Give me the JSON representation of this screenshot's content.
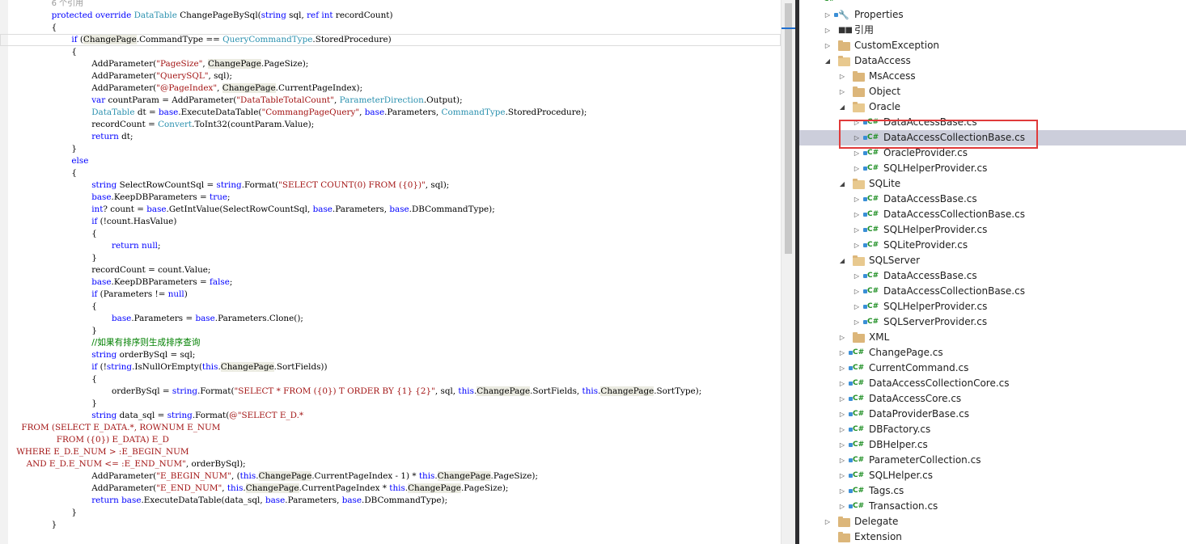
{
  "editor": {
    "lines": [
      {
        "indent": 8,
        "tokens": [
          {
            "t": "6 个引用",
            "c": "ref"
          }
        ]
      },
      {
        "indent": 8,
        "tokens": [
          {
            "t": "protected",
            "c": "kw"
          },
          {
            "t": " "
          },
          {
            "t": "override",
            "c": "kw"
          },
          {
            "t": " "
          },
          {
            "t": "DataTable",
            "c": "type"
          },
          {
            "t": " ChangePageBySql("
          },
          {
            "t": "string",
            "c": "kw"
          },
          {
            "t": " sql, "
          },
          {
            "t": "ref",
            "c": "kw"
          },
          {
            "t": " "
          },
          {
            "t": "int",
            "c": "kw"
          },
          {
            "t": " recordCount)"
          }
        ]
      },
      {
        "indent": 8,
        "tokens": [
          {
            "t": "{"
          }
        ]
      },
      {
        "indent": 12,
        "current": true,
        "tokens": [
          {
            "t": "if",
            "c": "kw"
          },
          {
            "t": " ("
          },
          {
            "t": "ChangePage",
            "c": "hl"
          },
          {
            "t": ".CommandType == "
          },
          {
            "t": "QueryCommandType",
            "c": "type"
          },
          {
            "t": ".StoredProcedure)"
          }
        ]
      },
      {
        "indent": 12,
        "tokens": [
          {
            "t": "{"
          }
        ]
      },
      {
        "indent": 16,
        "tokens": [
          {
            "t": "AddParameter("
          },
          {
            "t": "\"PageSize\"",
            "c": "str"
          },
          {
            "t": ", "
          },
          {
            "t": "ChangePage",
            "c": "hl"
          },
          {
            "t": ".PageSize);"
          }
        ]
      },
      {
        "indent": 16,
        "tokens": [
          {
            "t": "AddParameter("
          },
          {
            "t": "\"QuerySQL\"",
            "c": "str"
          },
          {
            "t": ", sql);"
          }
        ]
      },
      {
        "indent": 16,
        "tokens": [
          {
            "t": "AddParameter("
          },
          {
            "t": "\"@PageIndex\"",
            "c": "str"
          },
          {
            "t": ", "
          },
          {
            "t": "ChangePage",
            "c": "hl"
          },
          {
            "t": ".CurrentPageIndex);"
          }
        ]
      },
      {
        "indent": 16,
        "tokens": [
          {
            "t": "var",
            "c": "kw"
          },
          {
            "t": " countParam = AddParameter("
          },
          {
            "t": "\"DataTableTotalCount\"",
            "c": "str"
          },
          {
            "t": ", "
          },
          {
            "t": "ParameterDirection",
            "c": "type"
          },
          {
            "t": ".Output);"
          }
        ]
      },
      {
        "indent": 16,
        "tokens": [
          {
            "t": "DataTable",
            "c": "type"
          },
          {
            "t": " dt = "
          },
          {
            "t": "base",
            "c": "kw"
          },
          {
            "t": ".ExecuteDataTable("
          },
          {
            "t": "\"CommangPageQuery\"",
            "c": "str"
          },
          {
            "t": ", "
          },
          {
            "t": "base",
            "c": "kw"
          },
          {
            "t": ".Parameters, "
          },
          {
            "t": "CommandType",
            "c": "type"
          },
          {
            "t": ".StoredProcedure);"
          }
        ]
      },
      {
        "indent": 16,
        "tokens": [
          {
            "t": "recordCount = "
          },
          {
            "t": "Convert",
            "c": "type"
          },
          {
            "t": ".ToInt32(countParam.Value);"
          }
        ]
      },
      {
        "indent": 16,
        "tokens": [
          {
            "t": "return",
            "c": "kw"
          },
          {
            "t": " dt;"
          }
        ]
      },
      {
        "indent": 12,
        "tokens": [
          {
            "t": "}"
          }
        ]
      },
      {
        "indent": 12,
        "tokens": [
          {
            "t": "else",
            "c": "kw"
          }
        ]
      },
      {
        "indent": 12,
        "tokens": [
          {
            "t": "{"
          }
        ]
      },
      {
        "indent": 16,
        "tokens": [
          {
            "t": "string",
            "c": "kw"
          },
          {
            "t": " SelectRowCountSql = "
          },
          {
            "t": "string",
            "c": "kw"
          },
          {
            "t": ".Format("
          },
          {
            "t": "\"SELECT COUNT(0) FROM ({0})\"",
            "c": "str"
          },
          {
            "t": ", sql);"
          }
        ]
      },
      {
        "indent": 16,
        "tokens": [
          {
            "t": "base",
            "c": "kw"
          },
          {
            "t": ".KeepDBParameters = "
          },
          {
            "t": "true",
            "c": "kw"
          },
          {
            "t": ";"
          }
        ]
      },
      {
        "indent": 16,
        "tokens": [
          {
            "t": "int",
            "c": "kw"
          },
          {
            "t": "? count = "
          },
          {
            "t": "base",
            "c": "kw"
          },
          {
            "t": ".GetIntValue(SelectRowCountSql, "
          },
          {
            "t": "base",
            "c": "kw"
          },
          {
            "t": ".Parameters, "
          },
          {
            "t": "base",
            "c": "kw"
          },
          {
            "t": ".DBCommandType);"
          }
        ]
      },
      {
        "indent": 16,
        "tokens": [
          {
            "t": "if",
            "c": "kw"
          },
          {
            "t": " (!count.HasValue)"
          }
        ]
      },
      {
        "indent": 16,
        "tokens": [
          {
            "t": "{"
          }
        ]
      },
      {
        "indent": 20,
        "tokens": [
          {
            "t": "return",
            "c": "kw"
          },
          {
            "t": " "
          },
          {
            "t": "null",
            "c": "kw"
          },
          {
            "t": ";"
          }
        ]
      },
      {
        "indent": 16,
        "tokens": [
          {
            "t": "}"
          }
        ]
      },
      {
        "indent": 16,
        "tokens": [
          {
            "t": "recordCount = count.Value;"
          }
        ]
      },
      {
        "indent": 16,
        "tokens": [
          {
            "t": "base",
            "c": "kw"
          },
          {
            "t": ".KeepDBParameters = "
          },
          {
            "t": "false",
            "c": "kw"
          },
          {
            "t": ";"
          }
        ]
      },
      {
        "indent": 16,
        "tokens": [
          {
            "t": "if",
            "c": "kw"
          },
          {
            "t": " (Parameters != "
          },
          {
            "t": "null",
            "c": "kw"
          },
          {
            "t": ")"
          }
        ]
      },
      {
        "indent": 16,
        "tokens": [
          {
            "t": "{"
          }
        ]
      },
      {
        "indent": 20,
        "tokens": [
          {
            "t": "base",
            "c": "kw"
          },
          {
            "t": ".Parameters = "
          },
          {
            "t": "base",
            "c": "kw"
          },
          {
            "t": ".Parameters.Clone();"
          }
        ]
      },
      {
        "indent": 16,
        "tokens": [
          {
            "t": "}"
          }
        ]
      },
      {
        "indent": 16,
        "tokens": [
          {
            "t": "//如果有排序则生成排序查询",
            "c": "com"
          }
        ]
      },
      {
        "indent": 16,
        "tokens": [
          {
            "t": "string",
            "c": "kw"
          },
          {
            "t": " orderBySql = sql;"
          }
        ]
      },
      {
        "indent": 16,
        "tokens": [
          {
            "t": "if",
            "c": "kw"
          },
          {
            "t": " (!"
          },
          {
            "t": "string",
            "c": "kw"
          },
          {
            "t": ".IsNullOrEmpty("
          },
          {
            "t": "this",
            "c": "kw"
          },
          {
            "t": "."
          },
          {
            "t": "ChangePage",
            "c": "hl"
          },
          {
            "t": ".SortFields))"
          }
        ]
      },
      {
        "indent": 16,
        "tokens": [
          {
            "t": "{"
          }
        ]
      },
      {
        "indent": 20,
        "tokens": [
          {
            "t": "orderBySql = "
          },
          {
            "t": "string",
            "c": "kw"
          },
          {
            "t": ".Format("
          },
          {
            "t": "\"SELECT * FROM ({0}) T ORDER BY {1} {2}\"",
            "c": "str"
          },
          {
            "t": ", sql, "
          },
          {
            "t": "this",
            "c": "kw"
          },
          {
            "t": "."
          },
          {
            "t": "ChangePage",
            "c": "hl"
          },
          {
            "t": ".SortFields, "
          },
          {
            "t": "this",
            "c": "kw"
          },
          {
            "t": "."
          },
          {
            "t": "ChangePage",
            "c": "hl"
          },
          {
            "t": ".SortType);"
          }
        ]
      },
      {
        "indent": 16,
        "tokens": [
          {
            "t": "}"
          }
        ]
      },
      {
        "indent": 16,
        "tokens": [
          {
            "t": "string",
            "c": "kw"
          },
          {
            "t": " data_sql = "
          },
          {
            "t": "string",
            "c": "kw"
          },
          {
            "t": ".Format("
          },
          {
            "t": "@\"SELECT E_D.*",
            "c": "str"
          }
        ]
      },
      {
        "indent": 2,
        "tokens": [
          {
            "t": "FROM (SELECT E_DATA.*, ROWNUM E_NUM",
            "c": "str"
          }
        ]
      },
      {
        "indent": 9,
        "tokens": [
          {
            "t": "FROM ({0}) E_DATA) E_D",
            "c": "str"
          }
        ]
      },
      {
        "indent": 1,
        "tokens": [
          {
            "t": "WHERE E_D.E_NUM > :E_BEGIN_NUM",
            "c": "str"
          }
        ]
      },
      {
        "indent": 3,
        "tokens": [
          {
            "t": "AND E_D.E_NUM <= :E_END_NUM\"",
            "c": "str"
          },
          {
            "t": ", orderBySql);"
          }
        ]
      },
      {
        "indent": 16,
        "tokens": [
          {
            "t": "AddParameter("
          },
          {
            "t": "\"E_BEGIN_NUM\"",
            "c": "str"
          },
          {
            "t": ", ("
          },
          {
            "t": "this",
            "c": "kw"
          },
          {
            "t": "."
          },
          {
            "t": "ChangePage",
            "c": "hl"
          },
          {
            "t": ".CurrentPageIndex - 1) * "
          },
          {
            "t": "this",
            "c": "kw"
          },
          {
            "t": "."
          },
          {
            "t": "ChangePage",
            "c": "hl"
          },
          {
            "t": ".PageSize);"
          }
        ]
      },
      {
        "indent": 16,
        "tokens": [
          {
            "t": "AddParameter("
          },
          {
            "t": "\"E_END_NUM\"",
            "c": "str"
          },
          {
            "t": ", "
          },
          {
            "t": "this",
            "c": "kw"
          },
          {
            "t": "."
          },
          {
            "t": "ChangePage",
            "c": "hl"
          },
          {
            "t": ".CurrentPageIndex * "
          },
          {
            "t": "this",
            "c": "kw"
          },
          {
            "t": "."
          },
          {
            "t": "ChangePage",
            "c": "hl"
          },
          {
            "t": ".PageSize);"
          }
        ]
      },
      {
        "indent": 16,
        "tokens": [
          {
            "t": "return",
            "c": "kw"
          },
          {
            "t": " "
          },
          {
            "t": "base",
            "c": "kw"
          },
          {
            "t": ".ExecuteDataTable(data_sql, "
          },
          {
            "t": "base",
            "c": "kw"
          },
          {
            "t": ".Parameters, "
          },
          {
            "t": "base",
            "c": "kw"
          },
          {
            "t": ".DBCommandType);"
          }
        ]
      },
      {
        "indent": 12,
        "tokens": [
          {
            "t": "}"
          }
        ]
      },
      {
        "indent": 8,
        "tokens": [
          {
            "t": "}"
          }
        ]
      }
    ]
  },
  "explorer": {
    "items": [
      {
        "level": 0,
        "arrow": "",
        "icon": "cs-project",
        "label": ""
      },
      {
        "level": 1,
        "arrow": "closed",
        "icon": "wrench",
        "lock": true,
        "label": "Properties"
      },
      {
        "level": 1,
        "arrow": "closed",
        "icon": "refs",
        "label": "引用"
      },
      {
        "level": 1,
        "arrow": "closed",
        "icon": "folder",
        "label": "CustomException"
      },
      {
        "level": 1,
        "arrow": "open",
        "icon": "folder-open",
        "label": "DataAccess"
      },
      {
        "level": 2,
        "arrow": "closed",
        "icon": "folder",
        "label": "MsAccess"
      },
      {
        "level": 2,
        "arrow": "closed",
        "icon": "folder",
        "label": "Object"
      },
      {
        "level": 2,
        "arrow": "open",
        "icon": "folder-open",
        "label": "Oracle"
      },
      {
        "level": 3,
        "arrow": "closed",
        "icon": "cs",
        "lock": true,
        "label": "DataAccessBase.cs"
      },
      {
        "level": 3,
        "arrow": "closed",
        "icon": "cs",
        "lock": true,
        "label": "DataAccessCollectionBase.cs",
        "selected": true
      },
      {
        "level": 3,
        "arrow": "closed",
        "icon": "cs",
        "lock": true,
        "label": "OracleProvider.cs"
      },
      {
        "level": 3,
        "arrow": "closed",
        "icon": "cs",
        "lock": true,
        "label": "SQLHelperProvider.cs"
      },
      {
        "level": 2,
        "arrow": "open",
        "icon": "folder-open",
        "label": "SQLite"
      },
      {
        "level": 3,
        "arrow": "closed",
        "icon": "cs",
        "lock": true,
        "label": "DataAccessBase.cs"
      },
      {
        "level": 3,
        "arrow": "closed",
        "icon": "cs",
        "lock": true,
        "label": "DataAccessCollectionBase.cs"
      },
      {
        "level": 3,
        "arrow": "closed",
        "icon": "cs",
        "lock": true,
        "label": "SQLHelperProvider.cs"
      },
      {
        "level": 3,
        "arrow": "closed",
        "icon": "cs",
        "lock": true,
        "label": "SQLiteProvider.cs"
      },
      {
        "level": 2,
        "arrow": "open",
        "icon": "folder-open",
        "label": "SQLServer"
      },
      {
        "level": 3,
        "arrow": "closed",
        "icon": "cs",
        "lock": true,
        "label": "DataAccessBase.cs"
      },
      {
        "level": 3,
        "arrow": "closed",
        "icon": "cs",
        "lock": true,
        "label": "DataAccessCollectionBase.cs"
      },
      {
        "level": 3,
        "arrow": "closed",
        "icon": "cs",
        "lock": true,
        "label": "SQLHelperProvider.cs"
      },
      {
        "level": 3,
        "arrow": "closed",
        "icon": "cs",
        "lock": true,
        "label": "SQLServerProvider.cs"
      },
      {
        "level": 2,
        "arrow": "closed",
        "icon": "folder",
        "label": "XML"
      },
      {
        "level": 2,
        "arrow": "closed",
        "icon": "cs",
        "lock": true,
        "label": "ChangePage.cs"
      },
      {
        "level": 2,
        "arrow": "closed",
        "icon": "cs",
        "lock": true,
        "label": "CurrentCommand.cs"
      },
      {
        "level": 2,
        "arrow": "closed",
        "icon": "cs",
        "lock": true,
        "label": "DataAccessCollectionCore.cs"
      },
      {
        "level": 2,
        "arrow": "closed",
        "icon": "cs",
        "lock": true,
        "label": "DataAccessCore.cs"
      },
      {
        "level": 2,
        "arrow": "closed",
        "icon": "cs",
        "lock": true,
        "label": "DataProviderBase.cs"
      },
      {
        "level": 2,
        "arrow": "closed",
        "icon": "cs",
        "lock": true,
        "label": "DBFactory.cs"
      },
      {
        "level": 2,
        "arrow": "closed",
        "icon": "cs",
        "lock": true,
        "label": "DBHelper.cs"
      },
      {
        "level": 2,
        "arrow": "closed",
        "icon": "cs",
        "lock": true,
        "label": "ParameterCollection.cs"
      },
      {
        "level": 2,
        "arrow": "closed",
        "icon": "cs",
        "lock": true,
        "label": "SQLHelper.cs"
      },
      {
        "level": 2,
        "arrow": "closed",
        "icon": "cs",
        "lock": true,
        "label": "Tags.cs"
      },
      {
        "level": 2,
        "arrow": "closed",
        "icon": "cs",
        "lock": true,
        "label": "Transaction.cs"
      },
      {
        "level": 1,
        "arrow": "closed",
        "icon": "folder",
        "label": "Delegate"
      },
      {
        "level": 1,
        "arrow": "",
        "icon": "folder",
        "label": "Extension"
      }
    ]
  },
  "icons": {
    "arrow_closed": "▷",
    "arrow_open": "◢",
    "cs_glyph": "C#",
    "wrench_glyph": "🔧",
    "refs_glyph": "■■"
  },
  "colors": {
    "keyword": "#0000ff",
    "type": "#2b91af",
    "string": "#a31515",
    "comment": "#008000",
    "selection": "#cccedb",
    "highlight_box": "#e03a3a"
  }
}
